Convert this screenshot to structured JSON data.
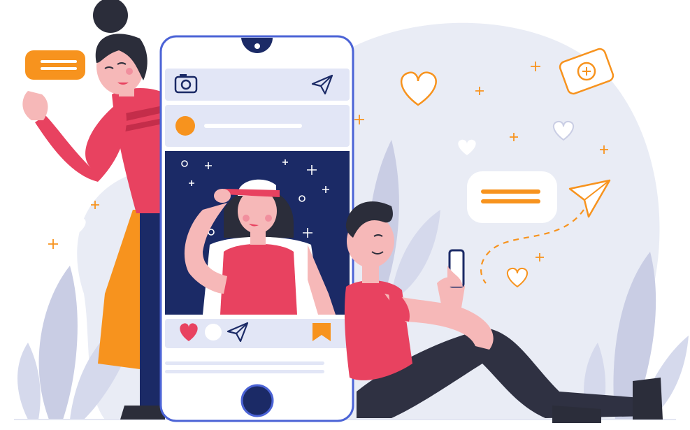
{
  "colors": {
    "accent_orange": "#f7931e",
    "accent_red": "#e84260",
    "navy": "#1b2a66",
    "phone_outline": "#4b63d6",
    "panel": "#e2e6f6",
    "blob": "#e9ecf5",
    "plant": "#c9cde4",
    "skin": "#f6b8b8",
    "hair": "#2b2d3a",
    "pants": "#2f3142"
  },
  "icons": {
    "camera": "camera-icon",
    "send": "paper-plane-icon",
    "like": "heart-icon",
    "comment": "comment-icon",
    "share": "paper-plane-icon",
    "bookmark": "bookmark-icon",
    "home_button": "home-button",
    "hearts": "heart-icon",
    "chat": "chat-bubble-icon",
    "sparkle": "sparkle-icon",
    "photo_camera": "camera-icon"
  }
}
